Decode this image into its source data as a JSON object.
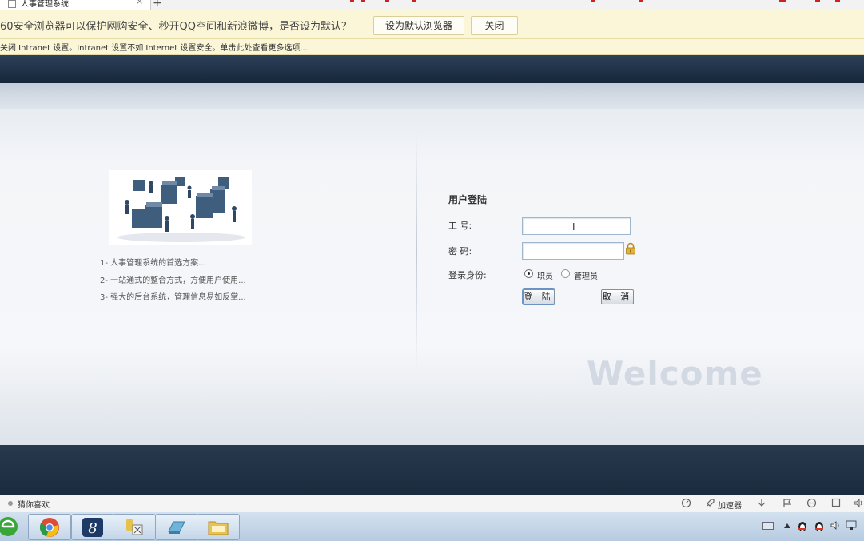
{
  "browser": {
    "tab_title": "人事管理系统",
    "tab_close": "×",
    "new_tab": "+"
  },
  "notify": {
    "message": "60安全浏览器可以保护网购安全、秒开QQ空间和新浪微博，是否设为默认？",
    "set_default_label": "设为默认浏览器",
    "close_label": "关闭",
    "intranet_message": "关闭 Intranet 设置。Intranet 设置不如 Internet 设置安全。单击此处查看更多选项..."
  },
  "intro": {
    "features": [
      "1- 人事管理系统的首选方案...",
      "2- 一站通式的整合方式，方便用户使用...",
      "3- 强大的后台系统，管理信息易如反掌..."
    ]
  },
  "login": {
    "title": "用户登陆",
    "id_label": "工  号:",
    "password_label": "密  码:",
    "role_label": "登录身份:",
    "id_value": "",
    "password_value": "",
    "roles": [
      "职员",
      "管理员"
    ],
    "selected_role": "职员",
    "login_button": "登 陆",
    "cancel_button": "取 消",
    "watermark": "Welcome"
  },
  "statusbar": {
    "left_text": "猜你喜欢",
    "accelerator_label": "加速器"
  },
  "colors": {
    "header_band": "#1f3148",
    "notify_bg": "#fbf6d8",
    "taskbar": "#c3d5e8"
  }
}
